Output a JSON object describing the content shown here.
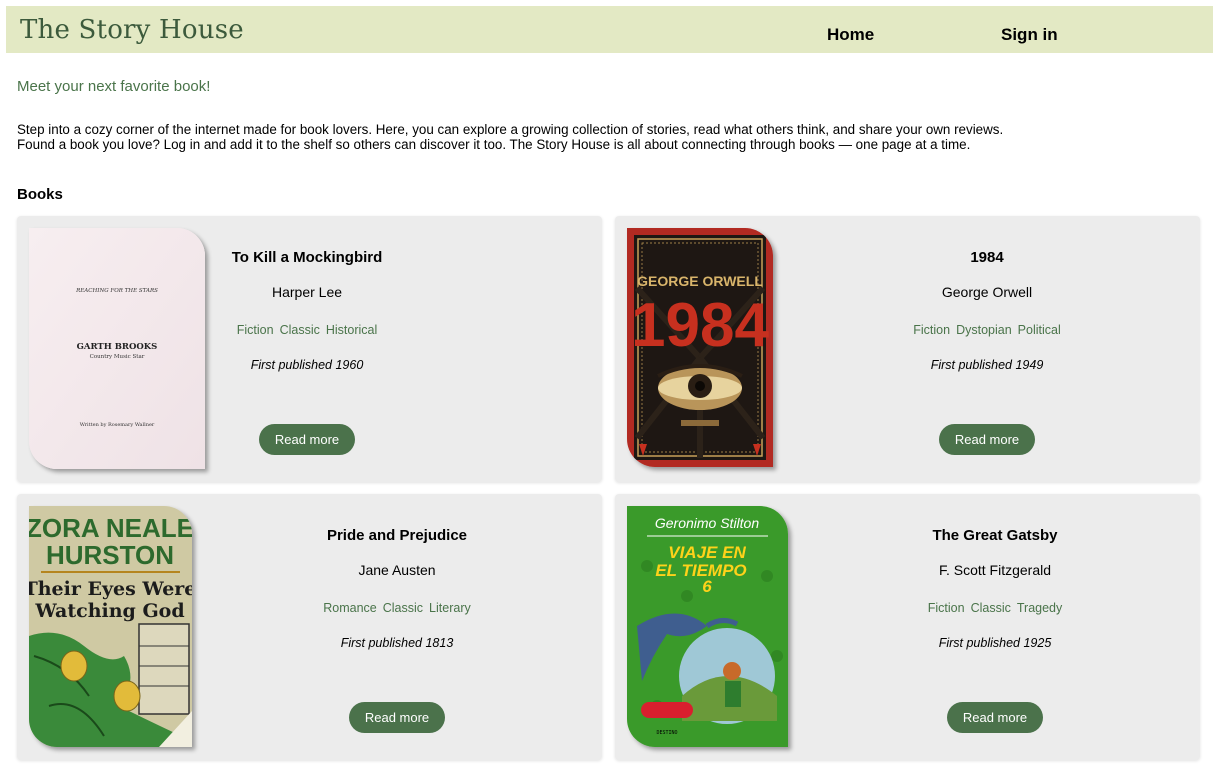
{
  "header": {
    "brand": "The Story House",
    "nav": {
      "home": "Home",
      "sign_in": "Sign in"
    }
  },
  "tagline": "Meet your next favorite book!",
  "intro": "Step into a cozy corner of the internet made for book lovers. Here, you can explore a growing collection of stories, read what others think, and share your own reviews. Found a book you love? Log in and add it to the shelf so others can discover it too. The Story House is all about connecting through books — one page at a time.",
  "section_title": "Books",
  "books": [
    {
      "title": "To Kill a Mockingbird",
      "author": "Harper Lee",
      "tags": [
        "Fiction",
        "Classic",
        "Historical"
      ],
      "published": "First published 1960",
      "button": "Read more",
      "cover_text": {
        "top": "REACHING FOR THE STARS",
        "name": "GARTH BROOKS",
        "sub": "Country Music Star",
        "bottom": "Written by Rosemary Wallner"
      }
    },
    {
      "title": "1984",
      "author": "George Orwell",
      "tags": [
        "Fiction",
        "Dystopian",
        "Political"
      ],
      "published": "First published 1949",
      "button": "Read more",
      "cover_text": {
        "author": "GEORGE ORWELL",
        "title": "1984"
      }
    },
    {
      "title": "Pride and Prejudice",
      "author": "Jane Austen",
      "tags": [
        "Romance",
        "Classic",
        "Literary"
      ],
      "published": "First published 1813",
      "button": "Read more",
      "cover_text": {
        "author1": "ZORA NEALE",
        "author2": "HURSTON",
        "title1": "Their Eyes Were",
        "title2": "Watching God"
      }
    },
    {
      "title": "The Great Gatsby",
      "author": "F. Scott Fitzgerald",
      "tags": [
        "Fiction",
        "Classic",
        "Tragedy"
      ],
      "published": "First published 1925",
      "button": "Read more",
      "cover_text": {
        "author": "Geronimo Stilton",
        "title1": "VIAJE EN",
        "title2": "EL TIEMPO",
        "title3": "6",
        "publisher": "DESTINO"
      }
    }
  ],
  "colors": {
    "navbar_bg": "#e3e9c4",
    "brand": "#3c5a3c",
    "accent_green": "#4b724b",
    "card_bg": "#ececec"
  }
}
